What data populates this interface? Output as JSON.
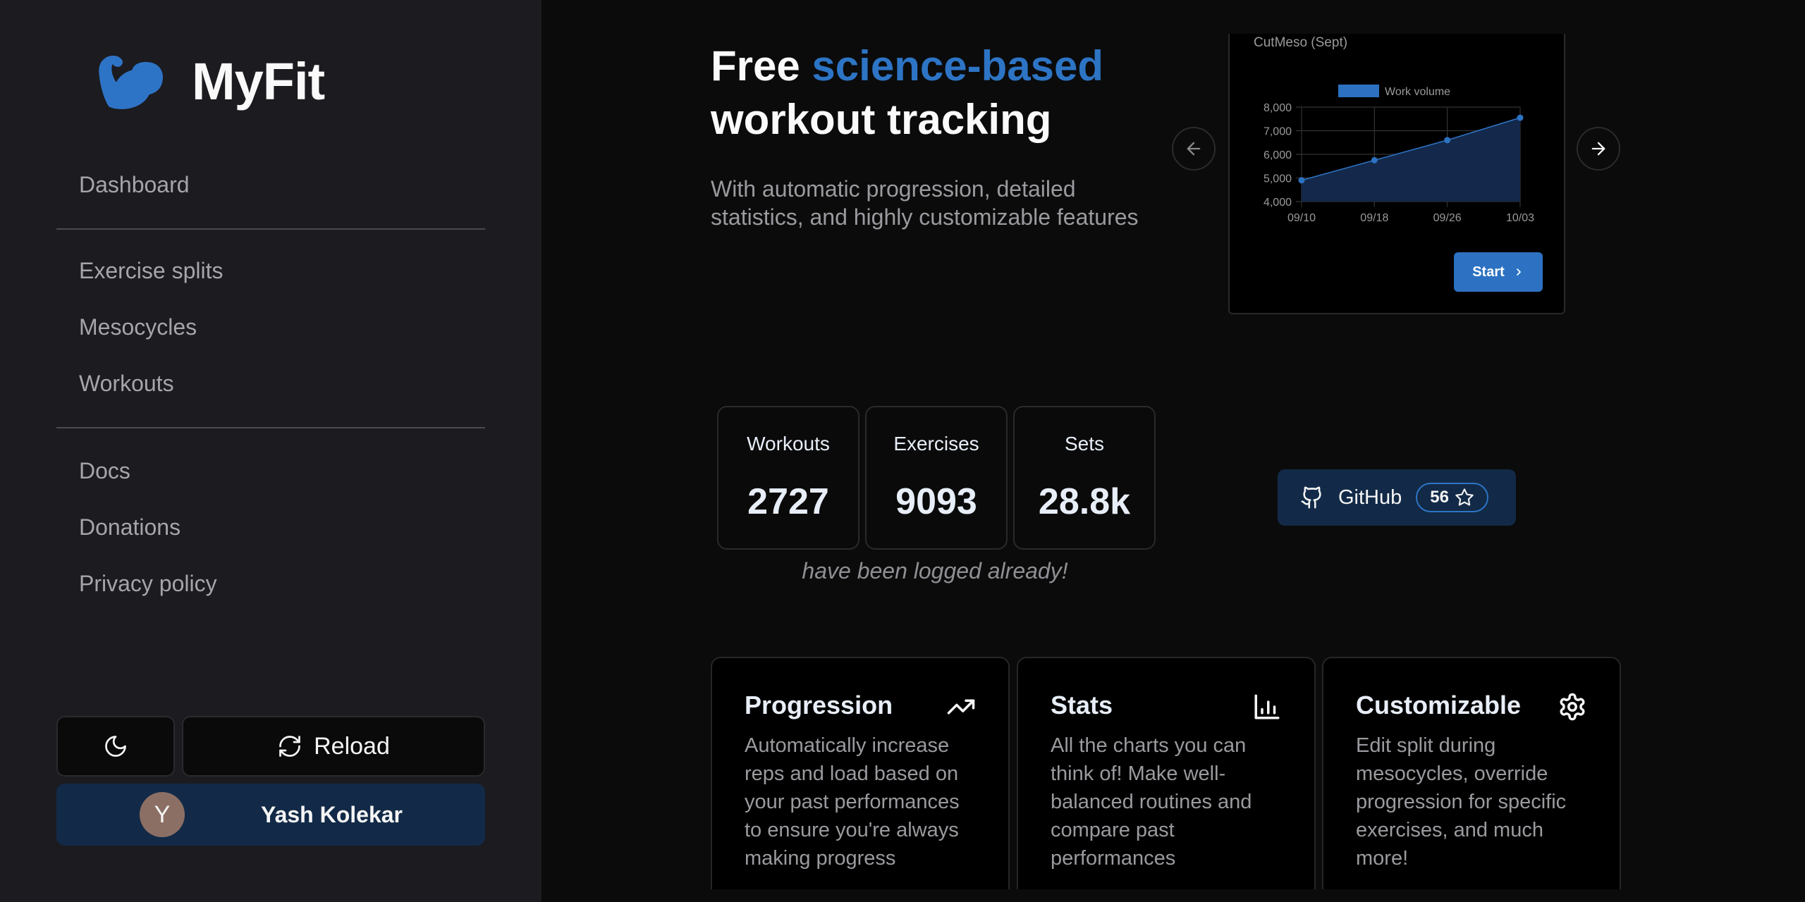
{
  "brand": {
    "name": "MyFit",
    "logo_icon": "flexed-biceps-icon",
    "accent_color": "#2d74c4"
  },
  "sidebar": {
    "groups": [
      [
        {
          "label": "Dashboard"
        }
      ],
      [
        {
          "label": "Exercise splits"
        },
        {
          "label": "Mesocycles"
        },
        {
          "label": "Workouts"
        }
      ],
      [
        {
          "label": "Docs"
        },
        {
          "label": "Donations"
        },
        {
          "label": "Privacy policy"
        }
      ]
    ],
    "theme_toggle_icon": "moon-icon",
    "reload_label": "Reload",
    "reload_icon": "refresh-icon",
    "user": {
      "initial": "Y",
      "name": "Yash Kolekar"
    }
  },
  "hero": {
    "title_prefix": "Free",
    "title_accent": "science-based",
    "title_suffix": "workout tracking",
    "subtitle": "With automatic progression, detailed statistics, and highly customizable features"
  },
  "carousel": {
    "card_title": "CutMeso (Sept)",
    "start_label": "Start",
    "prev_icon": "arrow-left-icon",
    "next_icon": "arrow-right-icon"
  },
  "chart_data": {
    "type": "area",
    "title": "CutMeso (Sept)",
    "legend": [
      "Work volume"
    ],
    "legend_position": "top",
    "categories": [
      "09/10",
      "09/18",
      "09/26",
      "10/03"
    ],
    "series": [
      {
        "name": "Work volume",
        "values": [
          4900,
          5750,
          6600,
          7550
        ],
        "color": "#2d72c2",
        "fill": "#13284a"
      }
    ],
    "ylim": [
      4000,
      8000
    ],
    "yticks": [
      "4,000",
      "5,000",
      "6,000",
      "7,000",
      "8,000"
    ],
    "grid": true,
    "xlabel": "",
    "ylabel": ""
  },
  "stats": {
    "items": [
      {
        "label": "Workouts",
        "value": "2727"
      },
      {
        "label": "Exercises",
        "value": "9093"
      },
      {
        "label": "Sets",
        "value": "28.8k"
      }
    ],
    "note": "have been logged already!"
  },
  "github": {
    "label": "GitHub",
    "stars": "56",
    "icon": "github-icon",
    "star_icon": "star-icon"
  },
  "features": [
    {
      "title": "Progression",
      "icon": "trending-up-icon",
      "description": "Automatically increase reps and load based on your past performances to ensure you're always making progress"
    },
    {
      "title": "Stats",
      "icon": "bar-chart-icon",
      "description": "All the charts you can think of! Make well-balanced routines and compare past performances"
    },
    {
      "title": "Customizable",
      "icon": "gear-icon",
      "description": "Edit split during mesocycles, override progression for specific exercises, and much more!"
    }
  ]
}
